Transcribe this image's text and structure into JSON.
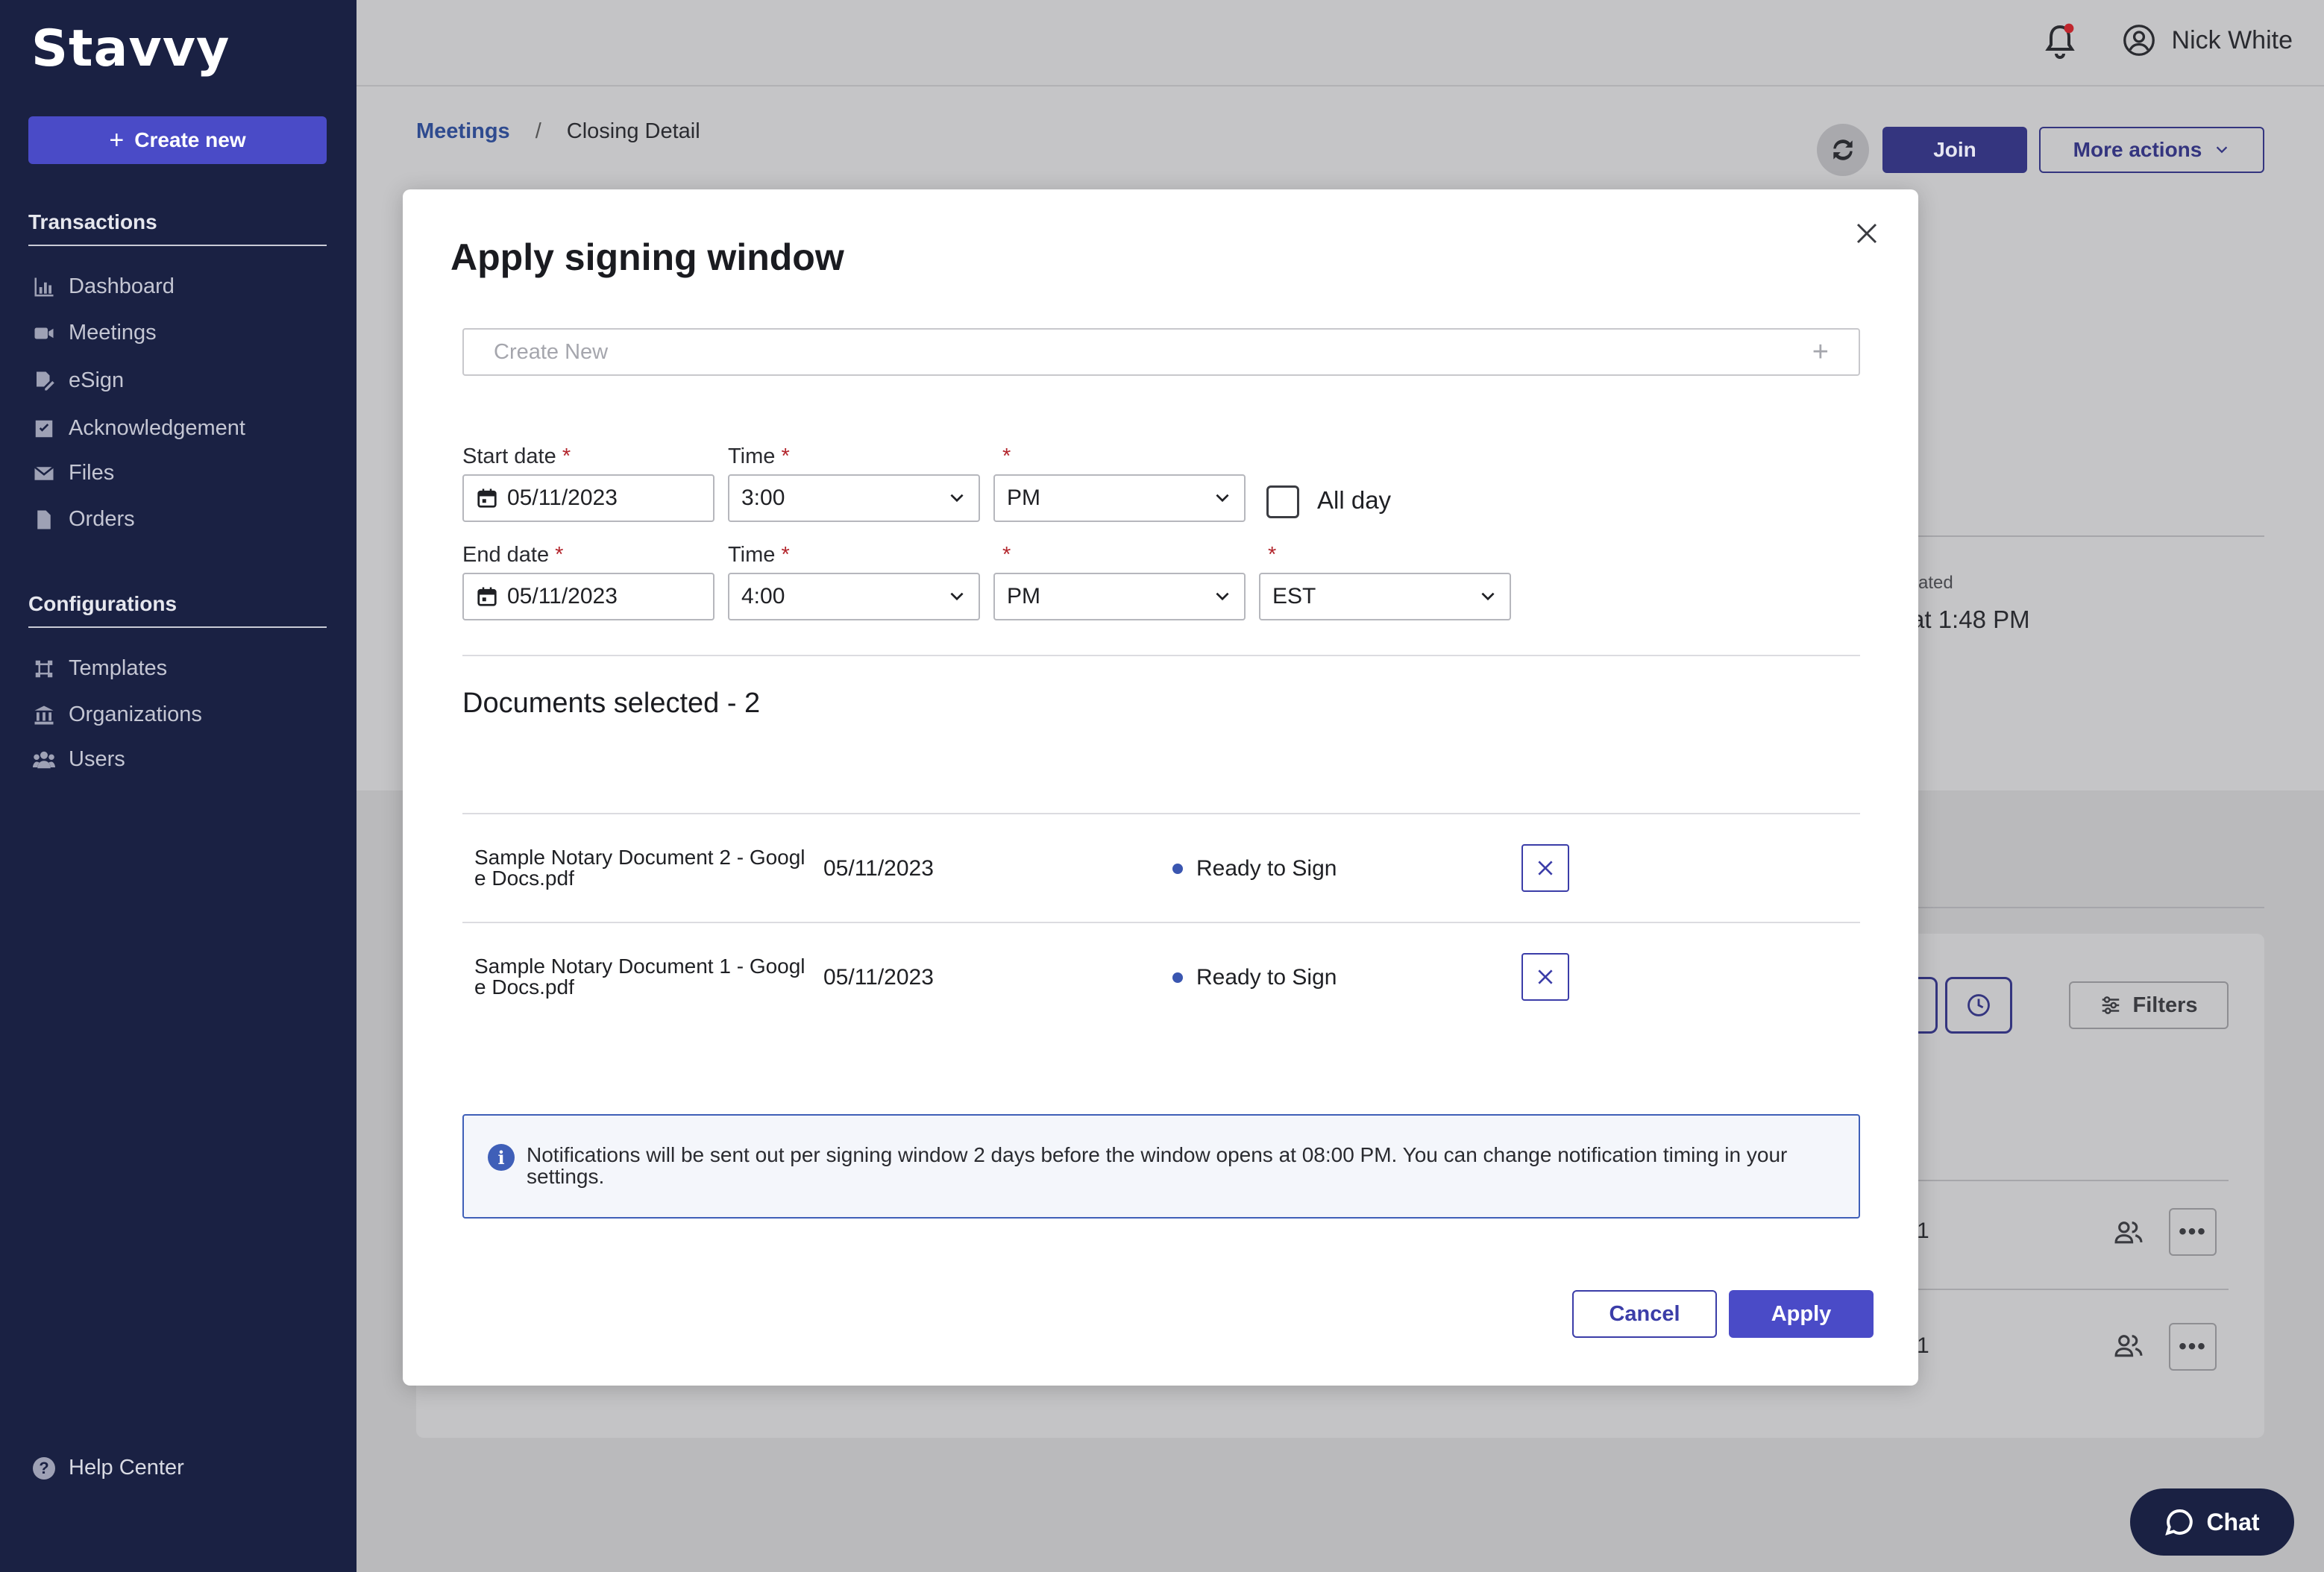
{
  "app": {
    "logo": "Stavvy"
  },
  "sidebar": {
    "create_label": "Create new",
    "sections": [
      {
        "title": "Transactions",
        "items": [
          {
            "label": "Dashboard",
            "icon": "chart-icon"
          },
          {
            "label": "Meetings",
            "icon": "video-icon"
          },
          {
            "label": "eSign",
            "icon": "signature-icon"
          },
          {
            "label": "Acknowledgement",
            "icon": "check-square-icon"
          },
          {
            "label": "Files",
            "icon": "envelope-icon"
          },
          {
            "label": "Orders",
            "icon": "file-icon"
          }
        ]
      },
      {
        "title": "Configurations",
        "items": [
          {
            "label": "Templates",
            "icon": "template-icon"
          },
          {
            "label": "Organizations",
            "icon": "bank-icon"
          },
          {
            "label": "Users",
            "icon": "users-icon"
          }
        ]
      }
    ],
    "help_label": "Help Center"
  },
  "header": {
    "user_name": "Nick White"
  },
  "page": {
    "breadcrumb": {
      "link": "Meetings",
      "separator": "/",
      "current": "Closing Detail"
    },
    "join_label": "Join",
    "more_actions_label": "More actions",
    "partial_label_created": "ated",
    "partial_time": "at 1:48 PM",
    "filters_label": "Filters",
    "row_partial_1": "1",
    "row_partial_2": "1"
  },
  "modal": {
    "title": "Apply signing window",
    "create_new_placeholder": "Create New",
    "start": {
      "date_label": "Start date",
      "date": "05/11/2023",
      "time_label": "Time",
      "time": "3:00",
      "ampm": "PM"
    },
    "end": {
      "date_label": "End date",
      "date": "05/11/2023",
      "time_label": "Time",
      "time": "4:00",
      "ampm": "PM",
      "timezone": "EST"
    },
    "required_mark": "*",
    "all_day_label": "All day",
    "documents_title": "Documents selected - 2",
    "documents": [
      {
        "name": "Sample Notary Document 2 - Google Docs.pdf",
        "date": "05/11/2023",
        "status": "Ready to Sign"
      },
      {
        "name": "Sample Notary Document 1 - Google Docs.pdf",
        "date": "05/11/2023",
        "status": "Ready to Sign"
      }
    ],
    "info_text": "Notifications will be sent out per signing window 2 days before the window opens at 08:00 PM. You can change notification timing in your settings.",
    "cancel_label": "Cancel",
    "apply_label": "Apply"
  },
  "chat": {
    "label": "Chat"
  },
  "colors": {
    "sidebar_bg": "#1a2143",
    "accent": "#4a4bc7",
    "required": "#b3262d",
    "info_border": "#3f5fb8"
  }
}
